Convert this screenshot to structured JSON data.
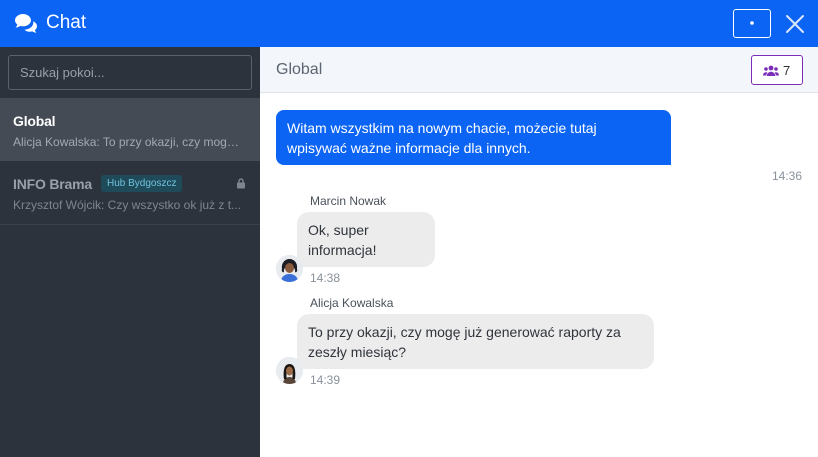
{
  "header": {
    "title": "Chat",
    "icons": {
      "chat": "chat-bubbles-icon",
      "settings": "gear-icon",
      "close": "close-icon"
    },
    "brand_color": "#0b64f4"
  },
  "sidebar": {
    "search_placeholder": "Szukaj pokoi...",
    "rooms": [
      {
        "name": "Global",
        "preview": "Alicja Kowalska: To przy okazji, czy mogę już generować raporty za zeszły miesiąc?",
        "active": true
      },
      {
        "name": "INFO Brama",
        "badge": "Hub Bydgoszcz",
        "preview": "Krzysztof Wójcik: Czy wszystko ok już z t...",
        "locked": true,
        "active": false
      }
    ]
  },
  "room": {
    "title": "Global",
    "members_count": "7",
    "members_icon": "users-icon"
  },
  "messages": {
    "own": {
      "text": "Witam wszystkim na nowym chacie, możecie tutaj wpisywać ważne informacje dla innych.",
      "time": "14:36"
    },
    "others": [
      {
        "sender": "Marcin Nowak",
        "text": "Ok, super informacja!",
        "time": "14:38",
        "avatar": "avatar-marcin"
      },
      {
        "sender": "Alicja Kowalska",
        "text": "To przy okazji, czy mogę już generować raporty za zeszły miesiąc?",
        "time": "14:39",
        "avatar": "avatar-alicja"
      }
    ]
  }
}
